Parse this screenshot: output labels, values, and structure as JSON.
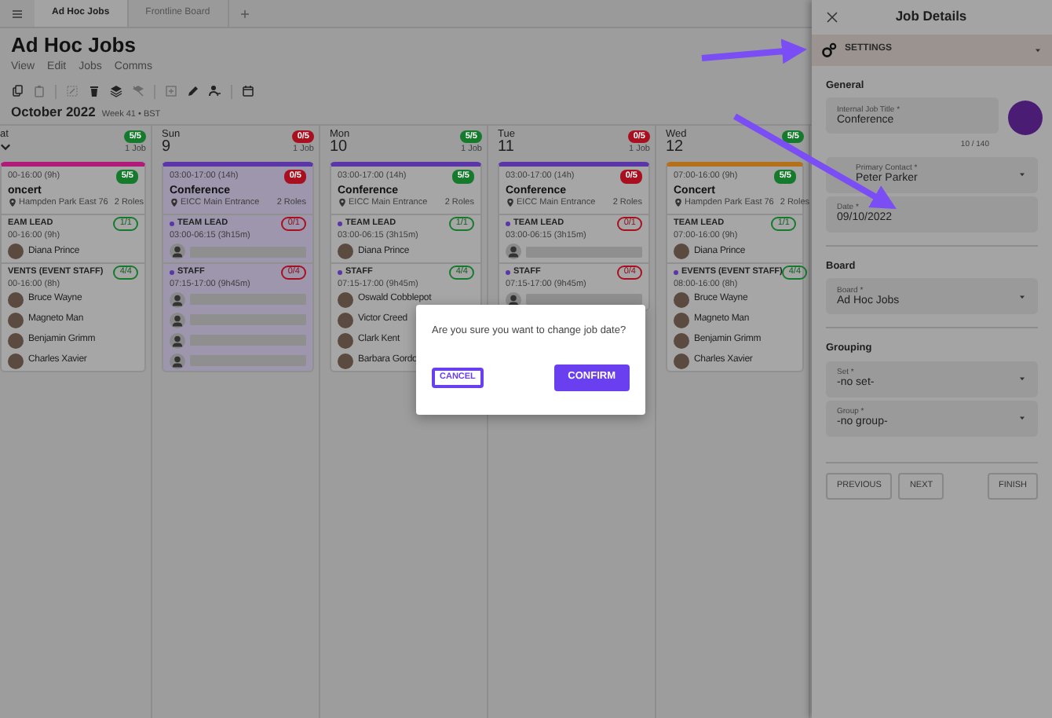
{
  "tabs": [
    {
      "label": "Ad Hoc Jobs",
      "selected": true
    },
    {
      "label": "Frontline Board",
      "selected": false
    }
  ],
  "page_title": "Ad Hoc Jobs",
  "menu": [
    "View",
    "Edit",
    "Jobs",
    "Comms"
  ],
  "toolbar": [
    {
      "disabled": false
    },
    {
      "disabled": true
    },
    {
      "disabled": true
    },
    {
      "disabled": false
    },
    {
      "disabled": false
    },
    {
      "disabled": true
    },
    {
      "disabled": true
    },
    {
      "disabled": false
    },
    {
      "disabled": false
    },
    {
      "disabled": false
    }
  ],
  "period": {
    "month": "October 2022",
    "week": "Week 41 • BST"
  },
  "days": [
    {
      "name": "at",
      "badge": "5/5",
      "full": true,
      "count": "1 Job",
      "job": {
        "color": "#b01a78",
        "selected": false,
        "time": "00-16:00 (9h)",
        "badge": "5/5",
        "full": true,
        "title": "oncert",
        "location": "Hampden Park East 76",
        "roles_count": "2 Roles",
        "roles": [
          {
            "name": "EAM LEAD",
            "dot": false,
            "time": "00-16:00 (9h)",
            "badge": "1/1",
            "full": true,
            "slots": [
              {
                "kind": "person",
                "name": "Diana Prince"
              }
            ]
          },
          {
            "name": "VENTS (EVENT STAFF)",
            "dot": false,
            "time": "00-16:00 (8h)",
            "badge": "4/4",
            "full": true,
            "slots": [
              {
                "kind": "person",
                "name": "Bruce Wayne"
              },
              {
                "kind": "person",
                "name": "Magneto Man"
              },
              {
                "kind": "person",
                "name": "Benjamin Grimm"
              },
              {
                "kind": "person",
                "name": "Charles Xavier"
              }
            ]
          }
        ]
      }
    },
    {
      "name": "Sun",
      "number": "9",
      "badge": "0/5",
      "full": false,
      "count": "1 Job",
      "job": {
        "color": "#5a36a8",
        "selected": true,
        "time": "03:00-17:00 (14h)",
        "badge": "0/5",
        "full": false,
        "title": "Conference",
        "location": "EICC Main Entrance",
        "roles_count": "2 Roles",
        "roles": [
          {
            "name": "TEAM LEAD",
            "dot": true,
            "time": "03:00-06:15 (3h15m)",
            "badge": "0/1",
            "full": false,
            "slots": [
              {
                "kind": "empty"
              }
            ]
          },
          {
            "name": "STAFF",
            "dot": true,
            "time": "07:15-17:00 (9h45m)",
            "badge": "0/4",
            "full": false,
            "slots": [
              {
                "kind": "empty"
              },
              {
                "kind": "empty"
              },
              {
                "kind": "empty"
              },
              {
                "kind": "empty"
              }
            ]
          }
        ]
      }
    },
    {
      "name": "Mon",
      "number": "10",
      "badge": "5/5",
      "full": true,
      "count": "1 Job",
      "job": {
        "color": "#5a36a8",
        "selected": false,
        "time": "03:00-17:00 (14h)",
        "badge": "5/5",
        "full": true,
        "title": "Conference",
        "location": "EICC Main Entrance",
        "roles_count": "2 Roles",
        "roles": [
          {
            "name": "TEAM LEAD",
            "dot": true,
            "time": "03:00-06:15 (3h15m)",
            "badge": "1/1",
            "full": true,
            "slots": [
              {
                "kind": "person",
                "name": "Diana Prince"
              }
            ]
          },
          {
            "name": "STAFF",
            "dot": true,
            "time": "07:15-17:00 (9h45m)",
            "badge": "4/4",
            "full": true,
            "slots": [
              {
                "kind": "person",
                "name": "Oswald Cobblepot"
              },
              {
                "kind": "person",
                "name": "Victor Creed"
              },
              {
                "kind": "person",
                "name": "Clark Kent"
              },
              {
                "kind": "person",
                "name": "Barbara Gordo"
              }
            ]
          }
        ]
      }
    },
    {
      "name": "Tue",
      "number": "11",
      "badge": "0/5",
      "full": false,
      "count": "1 Job",
      "job": {
        "color": "#5a36a8",
        "selected": false,
        "time": "03:00-17:00 (14h)",
        "badge": "0/5",
        "full": false,
        "title": "Conference",
        "location": "EICC Main Entrance",
        "roles_count": "2 Roles",
        "roles": [
          {
            "name": "TEAM LEAD",
            "dot": true,
            "time": "03:00-06:15 (3h15m)",
            "badge": "0/1",
            "full": false,
            "slots": [
              {
                "kind": "empty"
              }
            ]
          },
          {
            "name": "STAFF",
            "dot": true,
            "time": "07:15-17:00 (9h45m)",
            "badge": "0/4",
            "full": false,
            "slots": [
              {
                "kind": "empty"
              }
            ]
          }
        ]
      }
    },
    {
      "name": "Wed",
      "number": "12",
      "badge": "5/5",
      "full": true,
      "job": {
        "color": "#b5701a",
        "selected": false,
        "time": "07:00-16:00 (9h)",
        "badge": "5/5",
        "full": true,
        "title": "Concert",
        "location": "Hampden Park East 76",
        "roles_count": "2 Roles",
        "roles": [
          {
            "name": "TEAM LEAD",
            "dot": false,
            "time": "07:00-16:00 (9h)",
            "badge": "1/1",
            "full": true,
            "slots": [
              {
                "kind": "person",
                "name": "Diana Prince"
              }
            ]
          },
          {
            "name": "EVENTS (EVENT STAFF)",
            "dot": true,
            "time": "08:00-16:00 (8h)",
            "badge": "4/4",
            "full": true,
            "slots": [
              {
                "kind": "person",
                "name": "Bruce Wayne"
              },
              {
                "kind": "person",
                "name": "Magneto Man"
              },
              {
                "kind": "person",
                "name": "Benjamin Grimm"
              },
              {
                "kind": "person",
                "name": "Charles Xavier"
              }
            ]
          }
        ]
      }
    }
  ],
  "panel": {
    "title": "Job Details",
    "section": "SETTINGS",
    "groups": [
      {
        "heading": "General",
        "fields": [
          {
            "kind": "text",
            "label": "Internal Job Title *",
            "value": "Conference",
            "counter": "10 / 140",
            "color": "#4a1c74"
          },
          {
            "kind": "select",
            "label": "Primary Contact *",
            "value": "Peter Parker"
          },
          {
            "kind": "text",
            "label": "Date *",
            "value": "09/10/2022"
          }
        ]
      },
      {
        "heading": "Board",
        "fields": [
          {
            "kind": "select",
            "label": "Board *",
            "value": "Ad Hoc Jobs"
          }
        ]
      },
      {
        "heading": "Grouping",
        "fields": [
          {
            "kind": "select",
            "label": "Set *",
            "value": "-no set-"
          },
          {
            "kind": "select",
            "label": "Group *",
            "value": "-no group-"
          }
        ]
      }
    ],
    "buttons": [
      "PREVIOUS",
      "NEXT",
      "FINISH"
    ]
  },
  "dialog": {
    "message": "Are you sure you want to change job date?",
    "cancel": "CANCEL",
    "confirm": "CONFIRM"
  }
}
